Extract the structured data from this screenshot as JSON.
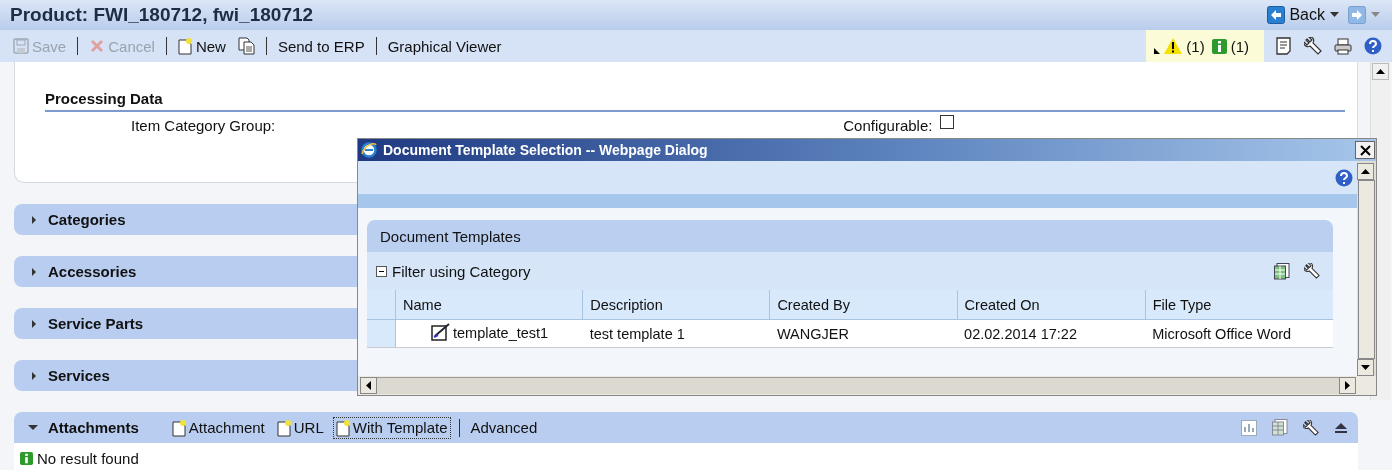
{
  "window": {
    "title": "Product: FWI_180712, fwi_180712"
  },
  "navigation": {
    "back_label": "Back"
  },
  "toolbar": {
    "items": [
      {
        "kind": "save",
        "label": "Save",
        "disabled": true,
        "separator": true
      },
      {
        "kind": "cancel",
        "label": "Cancel",
        "disabled": true,
        "separator": true
      },
      {
        "kind": "new",
        "label": "New",
        "disabled": false,
        "separator": false
      },
      {
        "kind": "copy",
        "disabled": false,
        "separator": true
      },
      {
        "kind": "text",
        "label": "Send to ERP",
        "disabled": false,
        "separator": true
      },
      {
        "kind": "text",
        "label": "Graphical Viewer",
        "disabled": false,
        "separator": false
      }
    ]
  },
  "messages": [
    {
      "kind": "warning",
      "count": "(1)"
    },
    {
      "kind": "info",
      "count": "(1)"
    }
  ],
  "processing_data": {
    "title": "Processing Data",
    "item_category_group_label": "Item Category Group:",
    "configurable": {
      "label": "Configurable:",
      "checked": false
    }
  },
  "sections": [
    {
      "title": "Categories",
      "expanded": false
    },
    {
      "title": "Accessories",
      "expanded": false
    },
    {
      "title": "Service Parts",
      "expanded": false
    },
    {
      "title": "Services",
      "expanded": false
    }
  ],
  "attachments": {
    "title": "Attachments",
    "expanded": true,
    "actions": [
      {
        "kind": "new",
        "label": "Attachment",
        "focused": false,
        "separator": false
      },
      {
        "kind": "new",
        "label": "URL",
        "focused": false,
        "separator": false
      },
      {
        "kind": "new",
        "label": "With Template",
        "focused": true,
        "separator": true
      },
      {
        "kind": "text",
        "label": "Advanced",
        "focused": false,
        "separator": false
      }
    ],
    "message": "No result found"
  },
  "dialog": {
    "title": "Document Template Selection -- Webpage Dialog",
    "panel_title": "Document Templates",
    "filter": {
      "label": "Filter using Category",
      "expanded": true
    },
    "table": {
      "columns": [
        "Name",
        "Description",
        "Created By",
        "Created On",
        "File Type"
      ],
      "rows": [
        {
          "selected": false,
          "cells": [
            "template_test1",
            "test template 1",
            "WANGJER",
            "02.02.2014 17:22",
            "Microsoft Office Word"
          ]
        }
      ]
    }
  }
}
